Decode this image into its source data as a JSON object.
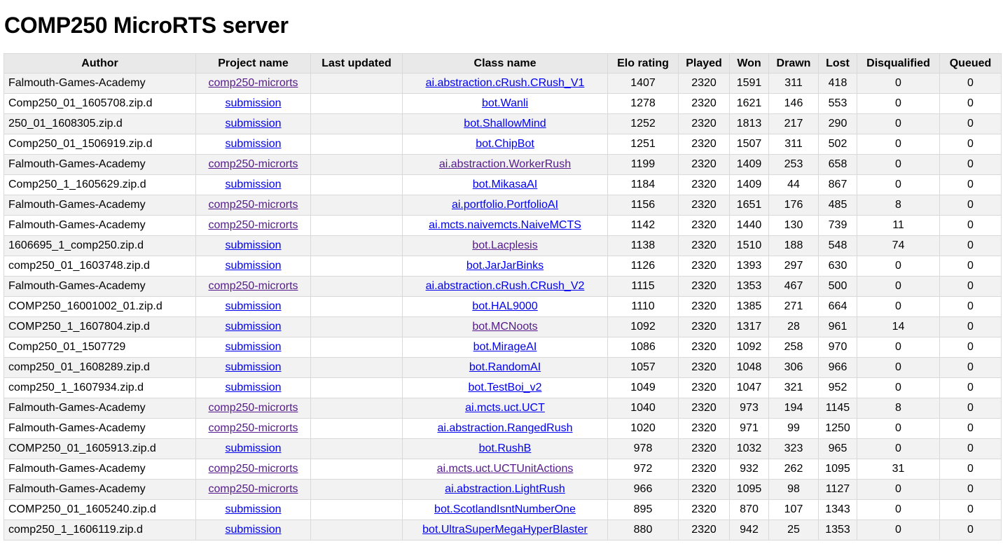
{
  "page": {
    "title": "COMP250 MicroRTS server"
  },
  "columns": [
    "Author",
    "Project name",
    "Last updated",
    "Class name",
    "Elo rating",
    "Played",
    "Won",
    "Drawn",
    "Lost",
    "Disqualified",
    "Queued"
  ],
  "link_colors": {
    "link": "#0000ee",
    "visited": "#551a8b"
  },
  "rows": [
    {
      "author": "Falmouth-Games-Academy",
      "project": "comp250-microrts",
      "project_visited": true,
      "last_updated": "",
      "class_name": "ai.abstraction.cRush.CRush_V1",
      "class_visited": false,
      "elo": "1407",
      "played": "2320",
      "won": "1591",
      "drawn": "311",
      "lost": "418",
      "disqualified": "0",
      "queued": "0"
    },
    {
      "author": "Comp250_01_1605708.zip.d",
      "project": "submission",
      "project_visited": false,
      "last_updated": "",
      "class_name": "bot.Wanli",
      "class_visited": false,
      "elo": "1278",
      "played": "2320",
      "won": "1621",
      "drawn": "146",
      "lost": "553",
      "disqualified": "0",
      "queued": "0"
    },
    {
      "author": "250_01_1608305.zip.d",
      "project": "submission",
      "project_visited": false,
      "last_updated": "",
      "class_name": "bot.ShallowMind",
      "class_visited": false,
      "elo": "1252",
      "played": "2320",
      "won": "1813",
      "drawn": "217",
      "lost": "290",
      "disqualified": "0",
      "queued": "0"
    },
    {
      "author": "Comp250_01_1506919.zip.d",
      "project": "submission",
      "project_visited": false,
      "last_updated": "",
      "class_name": "bot.ChipBot",
      "class_visited": false,
      "elo": "1251",
      "played": "2320",
      "won": "1507",
      "drawn": "311",
      "lost": "502",
      "disqualified": "0",
      "queued": "0"
    },
    {
      "author": "Falmouth-Games-Academy",
      "project": "comp250-microrts",
      "project_visited": true,
      "last_updated": "",
      "class_name": "ai.abstraction.WorkerRush",
      "class_visited": true,
      "elo": "1199",
      "played": "2320",
      "won": "1409",
      "drawn": "253",
      "lost": "658",
      "disqualified": "0",
      "queued": "0"
    },
    {
      "author": "Comp250_1_1605629.zip.d",
      "project": "submission",
      "project_visited": false,
      "last_updated": "",
      "class_name": "bot.MikasaAI",
      "class_visited": false,
      "elo": "1184",
      "played": "2320",
      "won": "1409",
      "drawn": "44",
      "lost": "867",
      "disqualified": "0",
      "queued": "0"
    },
    {
      "author": "Falmouth-Games-Academy",
      "project": "comp250-microrts",
      "project_visited": true,
      "last_updated": "",
      "class_name": "ai.portfolio.PortfolioAI",
      "class_visited": false,
      "elo": "1156",
      "played": "2320",
      "won": "1651",
      "drawn": "176",
      "lost": "485",
      "disqualified": "8",
      "queued": "0"
    },
    {
      "author": "Falmouth-Games-Academy",
      "project": "comp250-microrts",
      "project_visited": true,
      "last_updated": "",
      "class_name": "ai.mcts.naivemcts.NaiveMCTS",
      "class_visited": false,
      "elo": "1142",
      "played": "2320",
      "won": "1440",
      "drawn": "130",
      "lost": "739",
      "disqualified": "11",
      "queued": "0"
    },
    {
      "author": "1606695_1_comp250.zip.d",
      "project": "submission",
      "project_visited": false,
      "last_updated": "",
      "class_name": "bot.Lacplesis",
      "class_visited": true,
      "elo": "1138",
      "played": "2320",
      "won": "1510",
      "drawn": "188",
      "lost": "548",
      "disqualified": "74",
      "queued": "0"
    },
    {
      "author": "comp250_01_1603748.zip.d",
      "project": "submission",
      "project_visited": false,
      "last_updated": "",
      "class_name": "bot.JarJarBinks",
      "class_visited": false,
      "elo": "1126",
      "played": "2320",
      "won": "1393",
      "drawn": "297",
      "lost": "630",
      "disqualified": "0",
      "queued": "0"
    },
    {
      "author": "Falmouth-Games-Academy",
      "project": "comp250-microrts",
      "project_visited": true,
      "last_updated": "",
      "class_name": "ai.abstraction.cRush.CRush_V2",
      "class_visited": false,
      "elo": "1115",
      "played": "2320",
      "won": "1353",
      "drawn": "467",
      "lost": "500",
      "disqualified": "0",
      "queued": "0"
    },
    {
      "author": "COMP250_16001002_01.zip.d",
      "project": "submission",
      "project_visited": false,
      "last_updated": "",
      "class_name": "bot.HAL9000",
      "class_visited": false,
      "elo": "1110",
      "played": "2320",
      "won": "1385",
      "drawn": "271",
      "lost": "664",
      "disqualified": "0",
      "queued": "0"
    },
    {
      "author": "COMP250_1_1607804.zip.d",
      "project": "submission",
      "project_visited": false,
      "last_updated": "",
      "class_name": "bot.MCNoots",
      "class_visited": true,
      "elo": "1092",
      "played": "2320",
      "won": "1317",
      "drawn": "28",
      "lost": "961",
      "disqualified": "14",
      "queued": "0"
    },
    {
      "author": "Comp250_01_1507729",
      "project": "submission",
      "project_visited": false,
      "last_updated": "",
      "class_name": "bot.MirageAI",
      "class_visited": false,
      "elo": "1086",
      "played": "2320",
      "won": "1092",
      "drawn": "258",
      "lost": "970",
      "disqualified": "0",
      "queued": "0"
    },
    {
      "author": "comp250_01_1608289.zip.d",
      "project": "submission",
      "project_visited": false,
      "last_updated": "",
      "class_name": "bot.RandomAI",
      "class_visited": false,
      "elo": "1057",
      "played": "2320",
      "won": "1048",
      "drawn": "306",
      "lost": "966",
      "disqualified": "0",
      "queued": "0"
    },
    {
      "author": "comp250_1_1607934.zip.d",
      "project": "submission",
      "project_visited": false,
      "last_updated": "",
      "class_name": "bot.TestBoi_v2",
      "class_visited": false,
      "elo": "1049",
      "played": "2320",
      "won": "1047",
      "drawn": "321",
      "lost": "952",
      "disqualified": "0",
      "queued": "0"
    },
    {
      "author": "Falmouth-Games-Academy",
      "project": "comp250-microrts",
      "project_visited": true,
      "last_updated": "",
      "class_name": "ai.mcts.uct.UCT",
      "class_visited": false,
      "elo": "1040",
      "played": "2320",
      "won": "973",
      "drawn": "194",
      "lost": "1145",
      "disqualified": "8",
      "queued": "0"
    },
    {
      "author": "Falmouth-Games-Academy",
      "project": "comp250-microrts",
      "project_visited": true,
      "last_updated": "",
      "class_name": "ai.abstraction.RangedRush",
      "class_visited": false,
      "elo": "1020",
      "played": "2320",
      "won": "971",
      "drawn": "99",
      "lost": "1250",
      "disqualified": "0",
      "queued": "0"
    },
    {
      "author": "COMP250_01_1605913.zip.d",
      "project": "submission",
      "project_visited": false,
      "last_updated": "",
      "class_name": "bot.RushB",
      "class_visited": false,
      "elo": "978",
      "played": "2320",
      "won": "1032",
      "drawn": "323",
      "lost": "965",
      "disqualified": "0",
      "queued": "0"
    },
    {
      "author": "Falmouth-Games-Academy",
      "project": "comp250-microrts",
      "project_visited": true,
      "last_updated": "",
      "class_name": "ai.mcts.uct.UCTUnitActions",
      "class_visited": true,
      "elo": "972",
      "played": "2320",
      "won": "932",
      "drawn": "262",
      "lost": "1095",
      "disqualified": "31",
      "queued": "0"
    },
    {
      "author": "Falmouth-Games-Academy",
      "project": "comp250-microrts",
      "project_visited": true,
      "last_updated": "",
      "class_name": "ai.abstraction.LightRush",
      "class_visited": false,
      "elo": "966",
      "played": "2320",
      "won": "1095",
      "drawn": "98",
      "lost": "1127",
      "disqualified": "0",
      "queued": "0"
    },
    {
      "author": "COMP250_01_1605240.zip.d",
      "project": "submission",
      "project_visited": false,
      "last_updated": "",
      "class_name": "bot.ScotlandIsntNumberOne",
      "class_visited": false,
      "elo": "895",
      "played": "2320",
      "won": "870",
      "drawn": "107",
      "lost": "1343",
      "disqualified": "0",
      "queued": "0"
    },
    {
      "author": "comp250_1_1606119.zip.d",
      "project": "submission",
      "project_visited": false,
      "last_updated": "",
      "class_name": "bot.UltraSuperMegaHyperBlaster",
      "class_visited": false,
      "elo": "880",
      "played": "2320",
      "won": "942",
      "drawn": "25",
      "lost": "1353",
      "disqualified": "0",
      "queued": "0"
    }
  ]
}
